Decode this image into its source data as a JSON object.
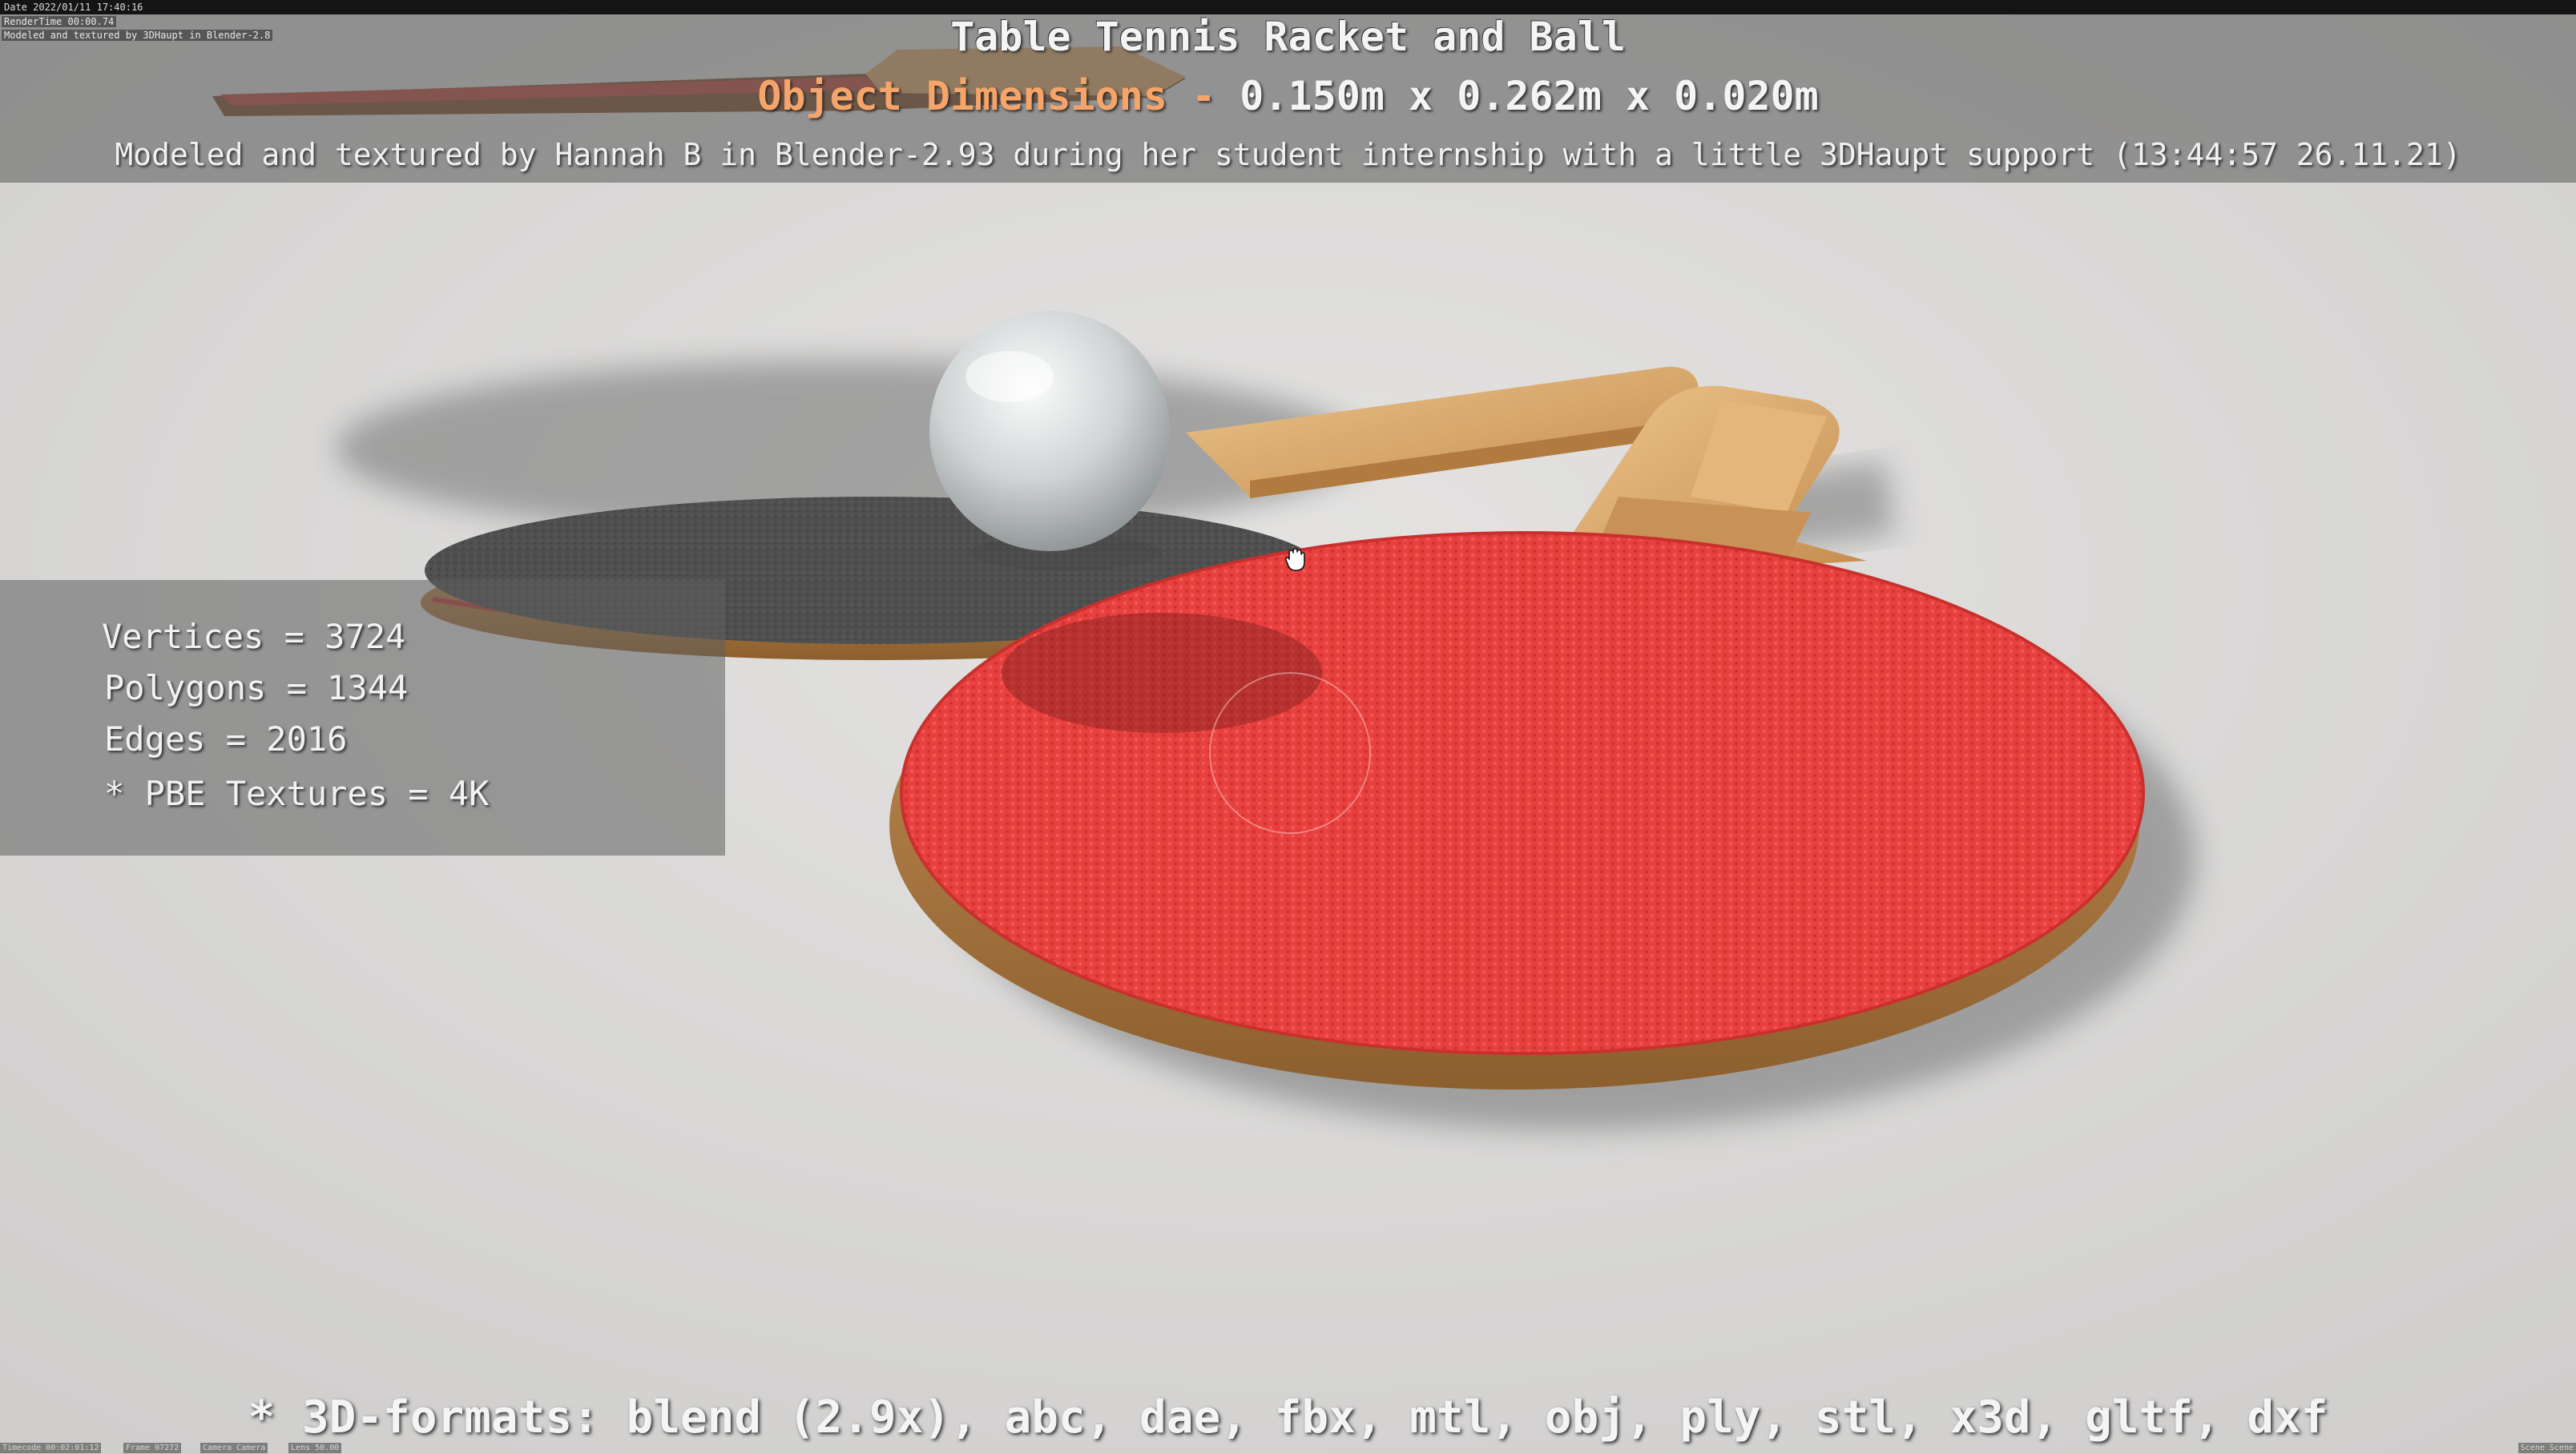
{
  "meta": {
    "date": "Date 2022/01/11 17:40:16",
    "render_time": "RenderTime 00:00.74",
    "credit_short": "Modeled and textured by 3DHaupt in Blender-2.8"
  },
  "header": {
    "title": "Table Tennis Racket and Ball",
    "dimensions_label": "Object Dimensions",
    "dimensions_separator": "-",
    "dimensions_value": "0.150m x 0.262m x 0.020m",
    "credit": "Modeled and textured by Hannah B in Blender-2.93 during her student internship with a little 3DHaupt support (13:44:57 26.11.21)"
  },
  "stats": {
    "vertices": "Vertices = 3724",
    "polygons": "Polygons = 1344",
    "edges": "Edges = 2016",
    "textures": "* PBE Textures = 4K"
  },
  "footer": {
    "formats": "* 3D-formats: blend (2.9x), abc, dae, fbx, mtl, obj, ply, stl, x3d, gltf, dxf"
  },
  "status_bar": {
    "timecode": "Timecode 00:02:01:12",
    "frame": "Frame 07272",
    "camera": "Camera Camera",
    "lens": "Lens 50.00",
    "scene": "Scene Scene"
  },
  "scene": {
    "objects": [
      "red-paddle",
      "black-paddle",
      "ping-pong-ball",
      "background-paddle"
    ],
    "colors": {
      "background": "#d9d8d7",
      "red_rubber": "#e8403e",
      "black_rubber": "#555555",
      "wood": "#d9a86a",
      "ball": "#d7dadb",
      "accent_orange": "#f5a46a"
    },
    "cursor_icon": "hand-grab-icon"
  }
}
